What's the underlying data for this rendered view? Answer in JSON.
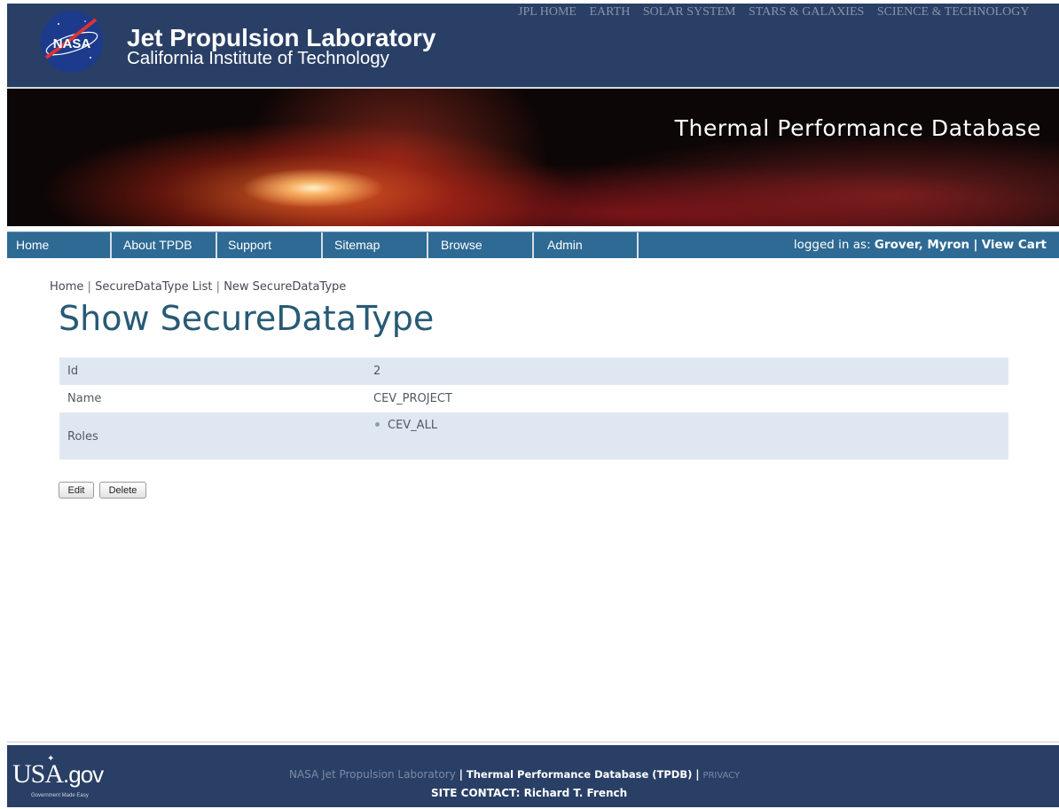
{
  "header": {
    "logo_text": "NASA",
    "title": "Jet Propulsion Laboratory",
    "subtitle": "California Institute of Technology",
    "top_links": [
      "JPL HOME",
      "EARTH",
      "SOLAR SYSTEM",
      "STARS & GALAXIES",
      "SCIENCE & TECHNOLOGY"
    ]
  },
  "banner": {
    "title": "Thermal Performance Database"
  },
  "nav": {
    "items": [
      "Home",
      "About TPDB",
      "Support",
      "Sitemap",
      "Browse",
      "Admin"
    ],
    "logged_in_prefix": "logged in as:",
    "user_name": "Grover, Myron",
    "separator": "|",
    "view_cart": "View Cart"
  },
  "breadcrumb": {
    "home": "Home",
    "list": "SecureDataType List",
    "new": "New SecureDataType",
    "separator": "|"
  },
  "page_title": "Show SecureDataType",
  "record": {
    "id_label": "Id",
    "id_value": "2",
    "name_label": "Name",
    "name_value": "CEV_PROJECT",
    "roles_label": "Roles",
    "roles": [
      "CEV_ALL"
    ]
  },
  "buttons": {
    "edit": "Edit",
    "delete": "Delete"
  },
  "footer": {
    "usa_logo_main": "USA",
    "usa_logo_suffix": ".gov",
    "usa_tagline": "Government Made Easy",
    "org": "NASA Jet Propulsion Laboratory",
    "separator": "|",
    "db": "Thermal Performance Database (TPDB)",
    "privacy": "PRIVACY",
    "contact": "SITE CONTACT: Richard T. French"
  },
  "colors": {
    "header_bg": "#293f66",
    "nav_bg": "#2e6a93",
    "title_color": "#275a75",
    "row_stripe": "#dfe8f2"
  }
}
